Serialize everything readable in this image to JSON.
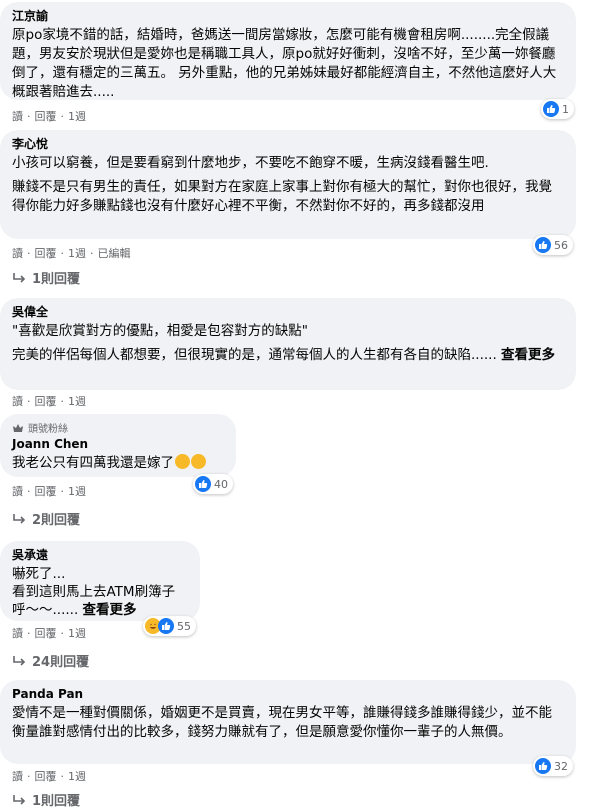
{
  "labels": {
    "read": "讀",
    "reply": "回覆",
    "dot": "·"
  },
  "comments": [
    {
      "author": "江京諭",
      "paragraphs": [
        "原po家境不錯的話，結婚時，爸媽送一間房當嫁妝，怎麼可能有機會租房啊........完全假議題，男友安於現狀但是愛妳也是稱職工具人，原po就好好衝刺，沒啥不好，至少萬一妳餐廳倒了，還有穩定的三萬五。 另外重點，他的兄弟姊妹最好都能經濟自主，不然他這麼好人大概跟著賠進去....."
      ],
      "time": "1週",
      "reaction_count": "1"
    },
    {
      "author": "李心悅",
      "paragraphs": [
        "小孩可以窮養，但是要看窮到什麼地步，不要吃不飽穿不暖，生病沒錢看醫生吧.",
        "賺錢不是只有男生的責任，如果對方在家庭上家事上對你有極大的幫忙，對你也很好，我覺得你能力好多賺點錢也沒有什麼好心裡不平衡，不然對你不好的，再多錢都沒用"
      ],
      "time": "1週",
      "edited": "已編輯",
      "reaction_count": "56",
      "replies": "1則回覆"
    },
    {
      "author": "吳偉全",
      "paragraphs": [
        "\"喜歡是欣賞對方的優點，相愛是包容對方的缺點\"",
        "完美的伴侶每個人都想要，但很現實的是，通常每個人的人生都有各自的缺陷......"
      ],
      "see_more": "查看更多",
      "time": "1週"
    },
    {
      "badge": "頭號粉絲",
      "author": "Joann Chen",
      "paragraphs": [
        "我老公只有四萬我還是嫁了"
      ],
      "time": "1週",
      "reaction_count": "40",
      "replies": "2則回覆"
    },
    {
      "author": "吳承遠",
      "paragraphs": [
        "嚇死了...",
        "看到這則馬上去ATM刷簿子",
        "呼～～......"
      ],
      "see_more": "查看更多",
      "time": "1週",
      "reaction_count": "55",
      "replies": "24則回覆"
    },
    {
      "author": "Panda Pan",
      "paragraphs": [
        "愛情不是一種對價關係，婚姻更不是買賣，現在男女平等，誰賺得錢多誰賺得錢少，並不能衡量誰對感情付出的比較多，錢努力賺就有了，但是願意愛你懂你一輩子的人無價。"
      ],
      "time": "1週",
      "reaction_count": "32",
      "replies": "1則回覆"
    }
  ]
}
